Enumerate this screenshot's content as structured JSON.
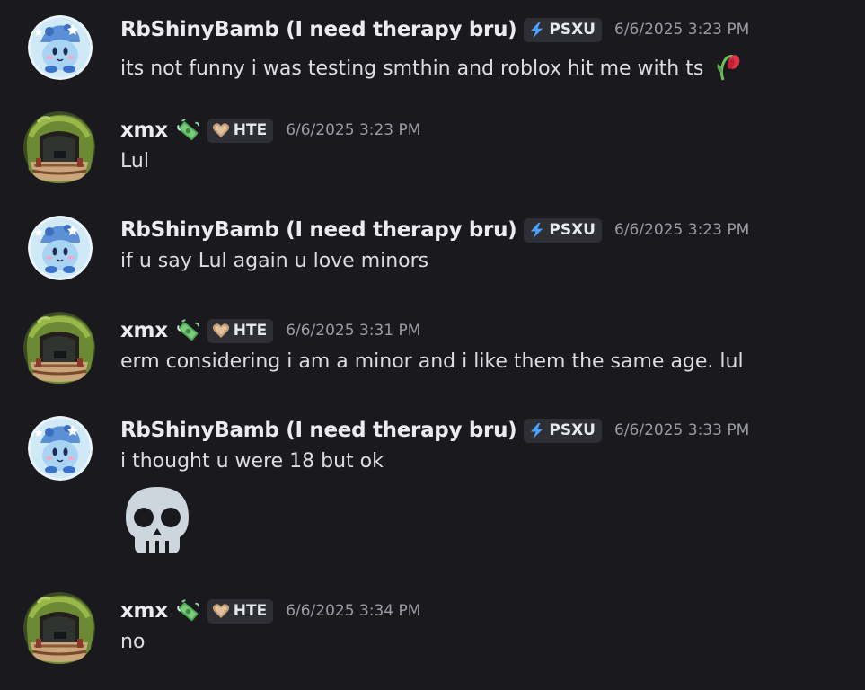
{
  "messages": [
    {
      "username": "RbShinyBamb (I need therapy bru)",
      "tag": "PSXU",
      "timestamp": "6/6/2025 3:23 PM",
      "text": "its not funny i was testing smthin and roblox hit me with ts"
    },
    {
      "username": "xmx",
      "tag": "HTE",
      "timestamp": "6/6/2025 3:23 PM",
      "text": "Lul"
    },
    {
      "username": "RbShinyBamb (I need therapy bru)",
      "tag": "PSXU",
      "timestamp": "6/6/2025 3:23 PM",
      "text": "if u say Lul again u love minors"
    },
    {
      "username": "xmx",
      "tag": "HTE",
      "timestamp": "6/6/2025 3:31 PM",
      "text": "erm considering i am a minor and i like them the same age. lul"
    },
    {
      "username": "RbShinyBamb (I need therapy bru)",
      "tag": "PSXU",
      "timestamp": "6/6/2025 3:33 PM",
      "text": "i thought u were 18 but ok"
    },
    {
      "username": "xmx",
      "tag": "HTE",
      "timestamp": "6/6/2025 3:34 PM",
      "text": "no"
    }
  ],
  "icons": {
    "kirby_avatar": "kirby-avatar",
    "house_avatar": "house-avatar",
    "money_emoji": "money-with-wings-emoji",
    "bolt": "lightning-bolt-icon",
    "heart": "heart-icon",
    "wilted_flower": "wilted-flower-emoji",
    "skull": "skull-emoji"
  },
  "colors": {
    "background": "#1a1a1e",
    "tag_bg": "#2e2f35",
    "bolt": "#4aa3ff",
    "timestamp": "#9a9ca3"
  }
}
